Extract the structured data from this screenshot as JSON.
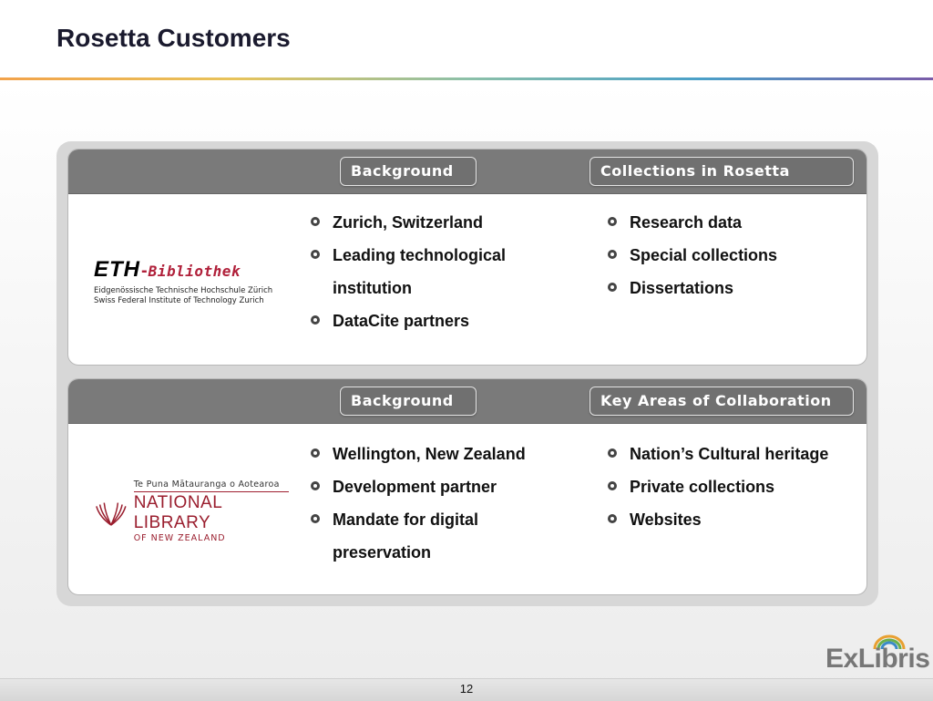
{
  "slide": {
    "title": "Rosetta Customers",
    "page_number": "12"
  },
  "customers": [
    {
      "logo": {
        "mark": "ETH",
        "name": "Bibliothek",
        "line1": "Eidgenössische Technische Hochschule Zürich",
        "line2": "Swiss Federal Institute of Technology Zurich"
      },
      "left_tab": "Background",
      "right_tab": "Collections in Rosetta",
      "left_bullets": [
        "Zurich, Switzerland",
        "Leading technological institution",
        "DataCite partners"
      ],
      "right_bullets": [
        "Research data",
        "Special collections",
        "Dissertations"
      ]
    },
    {
      "logo": {
        "maori": "Te Puna Mātauranga o Aotearoa",
        "name": "NATIONAL LIBRARY",
        "sub": "OF NEW ZEALAND"
      },
      "left_tab": "Background",
      "right_tab": "Key Areas of Collaboration",
      "left_bullets": [
        "Wellington, New Zealand",
        "Development partner",
        "Mandate for digital preservation"
      ],
      "right_bullets": [
        "Nation’s Cultural heritage",
        "Private collections",
        "Websites"
      ]
    }
  ],
  "branding": {
    "company": "ExLibris"
  },
  "colors": {
    "header_gray": "#7a7a7a",
    "accent_red": "#9a1e2e"
  }
}
